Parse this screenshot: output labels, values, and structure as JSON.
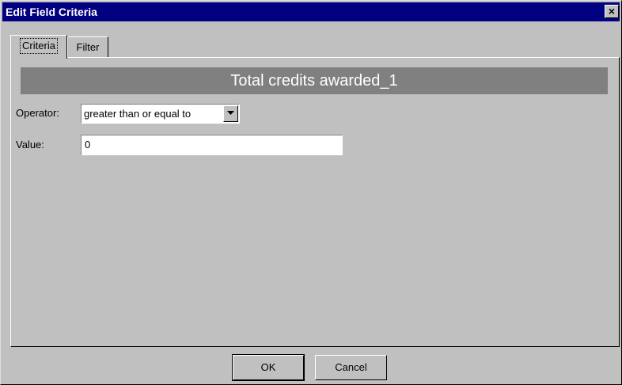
{
  "window": {
    "title": "Edit Field Criteria",
    "close_glyph": "×",
    "close_icon": "close-icon"
  },
  "tabs": [
    {
      "label": "Criteria",
      "active": true
    },
    {
      "label": "Filter",
      "active": false
    }
  ],
  "criteria": {
    "field_name": "Total credits awarded_1",
    "operator_label": "Operator:",
    "operator_value": "greater than or equal to",
    "value_label": "Value:",
    "value": "0"
  },
  "buttons": {
    "ok": "OK",
    "cancel": "Cancel"
  },
  "colors": {
    "titlebar": "#000080",
    "face": "#c0c0c0",
    "heading_bar": "#808080"
  }
}
